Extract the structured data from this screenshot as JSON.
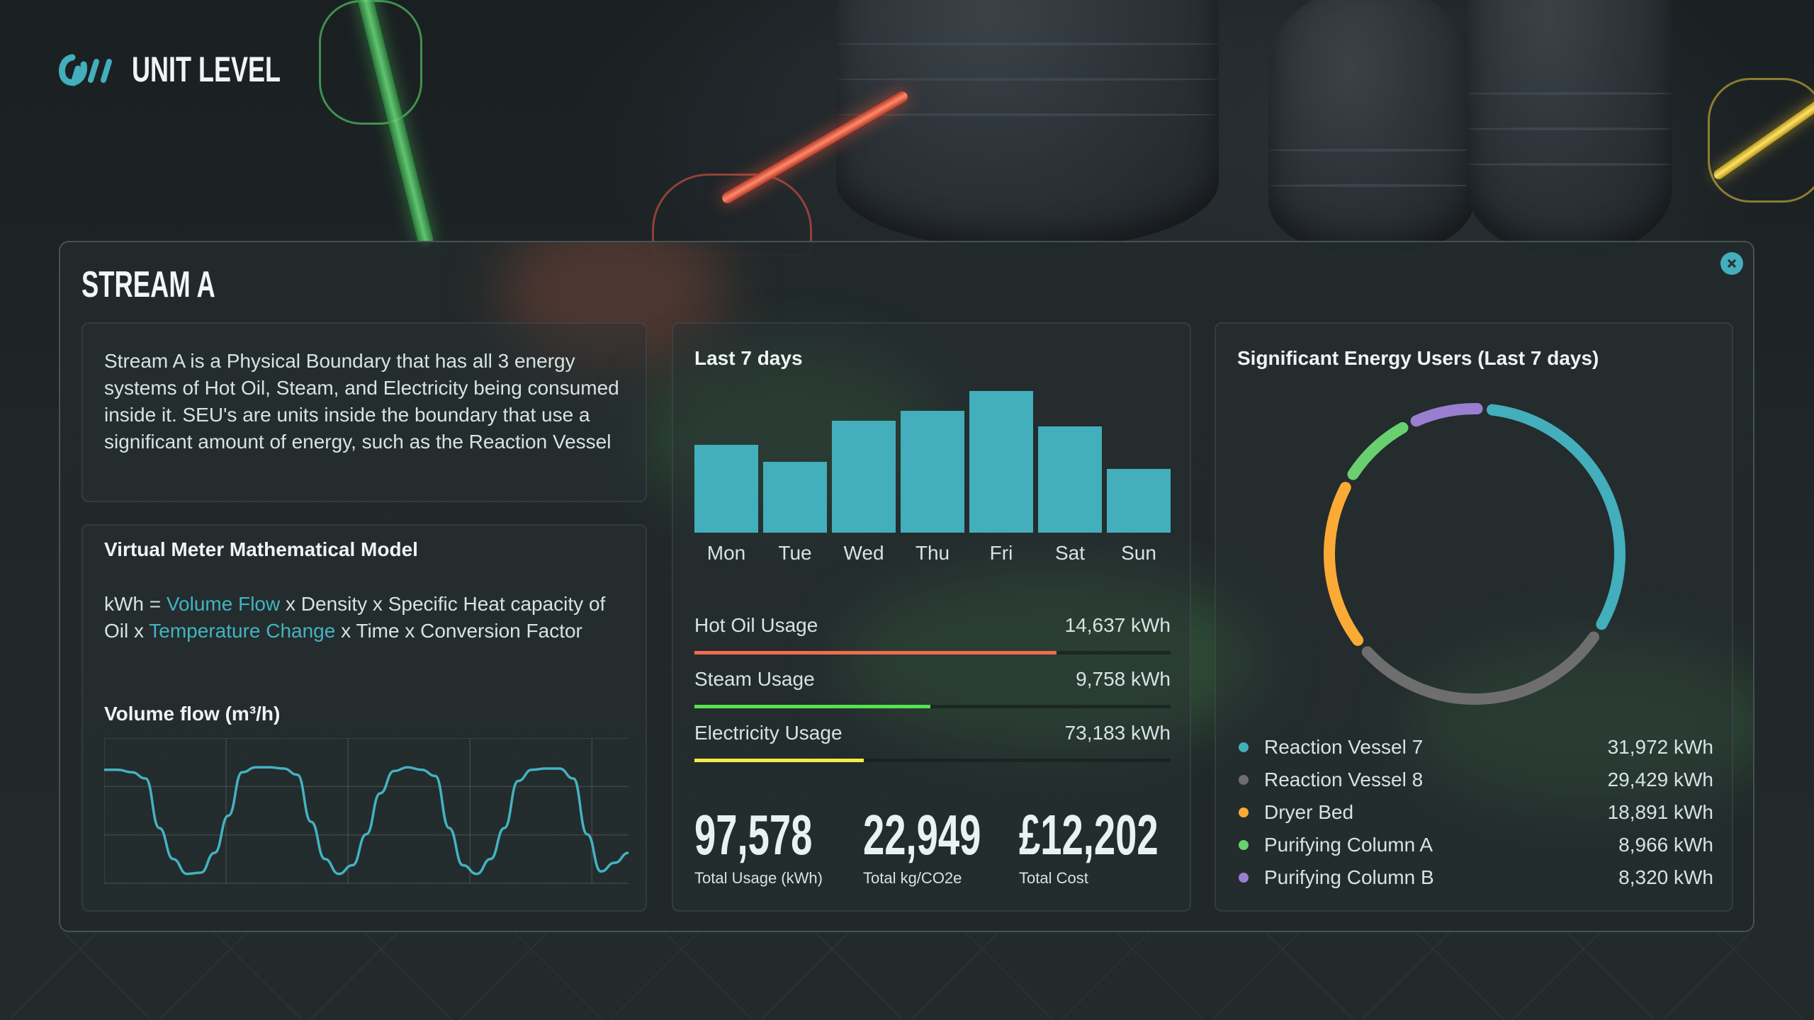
{
  "header": {
    "brand_title": "UNIT LEVEL",
    "logo_icon": "brand-logo-icon"
  },
  "panel": {
    "title": "STREAM A",
    "close_icon": "close-icon",
    "description": "Stream A is a Physical Boundary that has all 3 energy systems of Hot Oil, Steam, and Electricity being consumed inside it. SEU's are units inside the boundary that use a significant amount of energy, such as the Reaction Vessel",
    "model": {
      "title": "Virtual Meter Mathematical Model",
      "formula": {
        "prefix": "kWh = ",
        "term1": "Volume Flow",
        "mid1": " x Density x Specific Heat capacity of Oil x ",
        "term2": "Temperature Change",
        "suffix": " x Time x Conversion Factor"
      },
      "flow_chart_title": "Volume flow (m³/h)"
    },
    "week": {
      "title": "Last 7 days",
      "usage": [
        {
          "label": "Hot Oil Usage",
          "value": "14,637 kWh",
          "color": "#f26b4f",
          "fill_fraction": 0.76
        },
        {
          "label": "Steam Usage",
          "value": "9,758 kWh",
          "color": "#56e24f",
          "fill_fraction": 0.495
        },
        {
          "label": "Electricity Usage",
          "value": "73,183 kWh",
          "color": "#f2ec4a",
          "fill_fraction": 0.355
        }
      ],
      "totals": [
        {
          "value": "97,578",
          "label": "Total Usage (kWh)"
        },
        {
          "value": "22,949",
          "label": "Total kg/CO2e"
        },
        {
          "value": "£12,202",
          "label": "Total Cost"
        }
      ]
    },
    "seu": {
      "title": "Significant Energy Users (Last 7 days)",
      "items": [
        {
          "label": "Reaction Vessel 7",
          "value": "31,972 kWh",
          "color": "#43aebc"
        },
        {
          "label": "Reaction Vessel 8",
          "value": "29,429 kWh",
          "color": "#6e6e6e"
        },
        {
          "label": "Dryer Bed",
          "value": "18,891 kWh",
          "color": "#fbaa35"
        },
        {
          "label": "Purifying Column A",
          "value": "8,966 kWh",
          "color": "#69d06f"
        },
        {
          "label": "Purifying Column B",
          "value": "8,320 kWh",
          "color": "#9a7fd0"
        }
      ]
    }
  },
  "colors": {
    "accent": "#43aebc",
    "bar": "#43aebc",
    "line": "#43b3c1"
  },
  "chart_data": [
    {
      "type": "bar",
      "title": "Last 7 days",
      "categories": [
        "Mon",
        "Tue",
        "Wed",
        "Thu",
        "Fri",
        "Sat",
        "Sun"
      ],
      "values": [
        62,
        50,
        79,
        86,
        100,
        75,
        45
      ],
      "xlabel": "",
      "ylabel": "",
      "ylim": [
        0,
        100
      ],
      "grid": false,
      "note": "relative values (no y-axis shown)"
    },
    {
      "type": "line",
      "title": "Volume flow (m³/h)",
      "x": [
        0,
        1,
        2,
        3,
        4,
        5,
        6,
        7,
        8,
        9,
        10,
        11,
        12,
        13,
        14,
        15,
        16,
        17,
        18,
        19,
        20,
        21,
        22,
        23,
        24,
        25,
        26,
        27,
        28,
        29,
        30,
        31,
        32,
        33,
        34,
        35,
        36,
        37,
        38,
        39,
        40,
        41,
        42,
        43,
        44,
        45,
        46,
        47,
        48,
        49,
        50
      ],
      "series": [
        {
          "name": "Volume flow",
          "values": [
            0.87,
            0.87,
            0.85,
            0.8,
            0.4,
            0.15,
            0.03,
            0.04,
            0.2,
            0.5,
            0.85,
            0.89,
            0.89,
            0.88,
            0.83,
            0.45,
            0.15,
            0.03,
            0.1,
            0.35,
            0.68,
            0.86,
            0.89,
            0.87,
            0.82,
            0.4,
            0.1,
            0.03,
            0.15,
            0.4,
            0.78,
            0.87,
            0.88,
            0.88,
            0.8,
            0.35,
            0.05,
            0.12,
            0.2
          ]
        }
      ],
      "xlim": [
        0,
        38
      ],
      "ylim": [
        0,
        1
      ],
      "grid": true,
      "xlabel": "",
      "ylabel": "",
      "note": "no tick labels shown; values normalised to the plot height"
    },
    {
      "type": "pie",
      "title": "Significant Energy Users (Last 7 days)",
      "categories": [
        "Reaction Vessel 7",
        "Reaction Vessel 8",
        "Dryer Bed",
        "Purifying Column A",
        "Purifying Column B"
      ],
      "values": [
        31972,
        29429,
        18891,
        8966,
        8320
      ],
      "units": "kWh",
      "legend": "bottom",
      "donut": true
    }
  ]
}
